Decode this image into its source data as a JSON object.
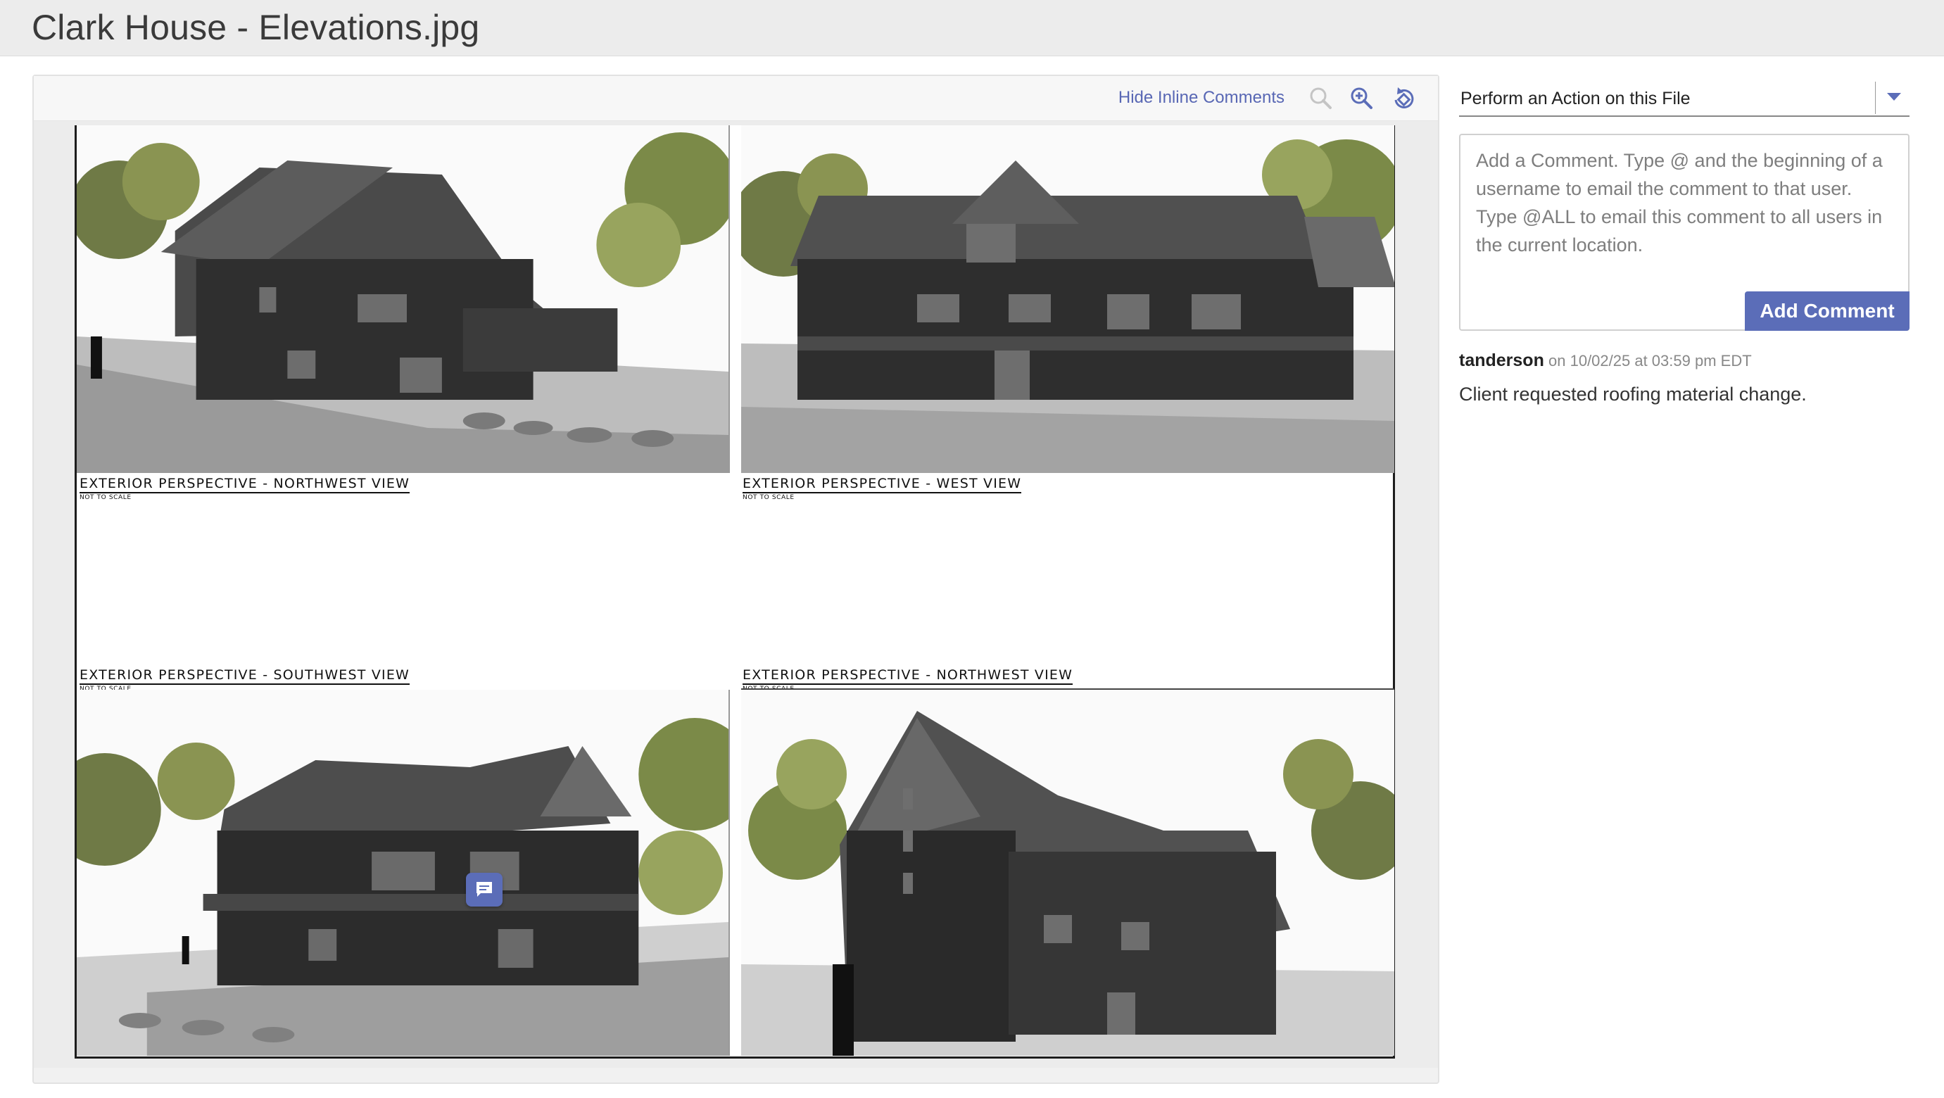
{
  "window": {
    "title": "Clark House - Elevations.jpg"
  },
  "viewer": {
    "toolbar": {
      "hide_comments_label": "Hide Inline Comments",
      "icons": [
        "zoom-out-icon",
        "zoom-in-icon",
        "rotate-icon"
      ]
    },
    "sheet": {
      "captions": [
        {
          "title": "Exterior Perspective - Northwest View",
          "subtitle": "Not to Scale"
        },
        {
          "title": "Exterior Perspective - West View",
          "subtitle": "Not to Scale"
        },
        {
          "title": "Exterior Perspective - Southwest View",
          "subtitle": "Not to Scale"
        },
        {
          "title": "Exterior Perspective - Northwest View",
          "subtitle": "Not to Scale"
        }
      ]
    },
    "inline_comment_icon": "comment-bubble-icon"
  },
  "sidebar": {
    "action_select": {
      "label": "Perform an Action on this File"
    },
    "comment_form": {
      "placeholder": "Add a Comment. Type @ and the beginning of a username to email the comment to that user. Type @ALL to email this comment to all users in the current location.",
      "submit_label": "Add Comment"
    },
    "comments": [
      {
        "user": "tanderson",
        "on": "on",
        "timestamp": "10/02/25 at 03:59 pm EDT",
        "text": "Client requested roofing material change."
      }
    ]
  },
  "colors": {
    "accent": "#5b6db8",
    "link": "#5867b4",
    "titlebar": "#ececec"
  }
}
